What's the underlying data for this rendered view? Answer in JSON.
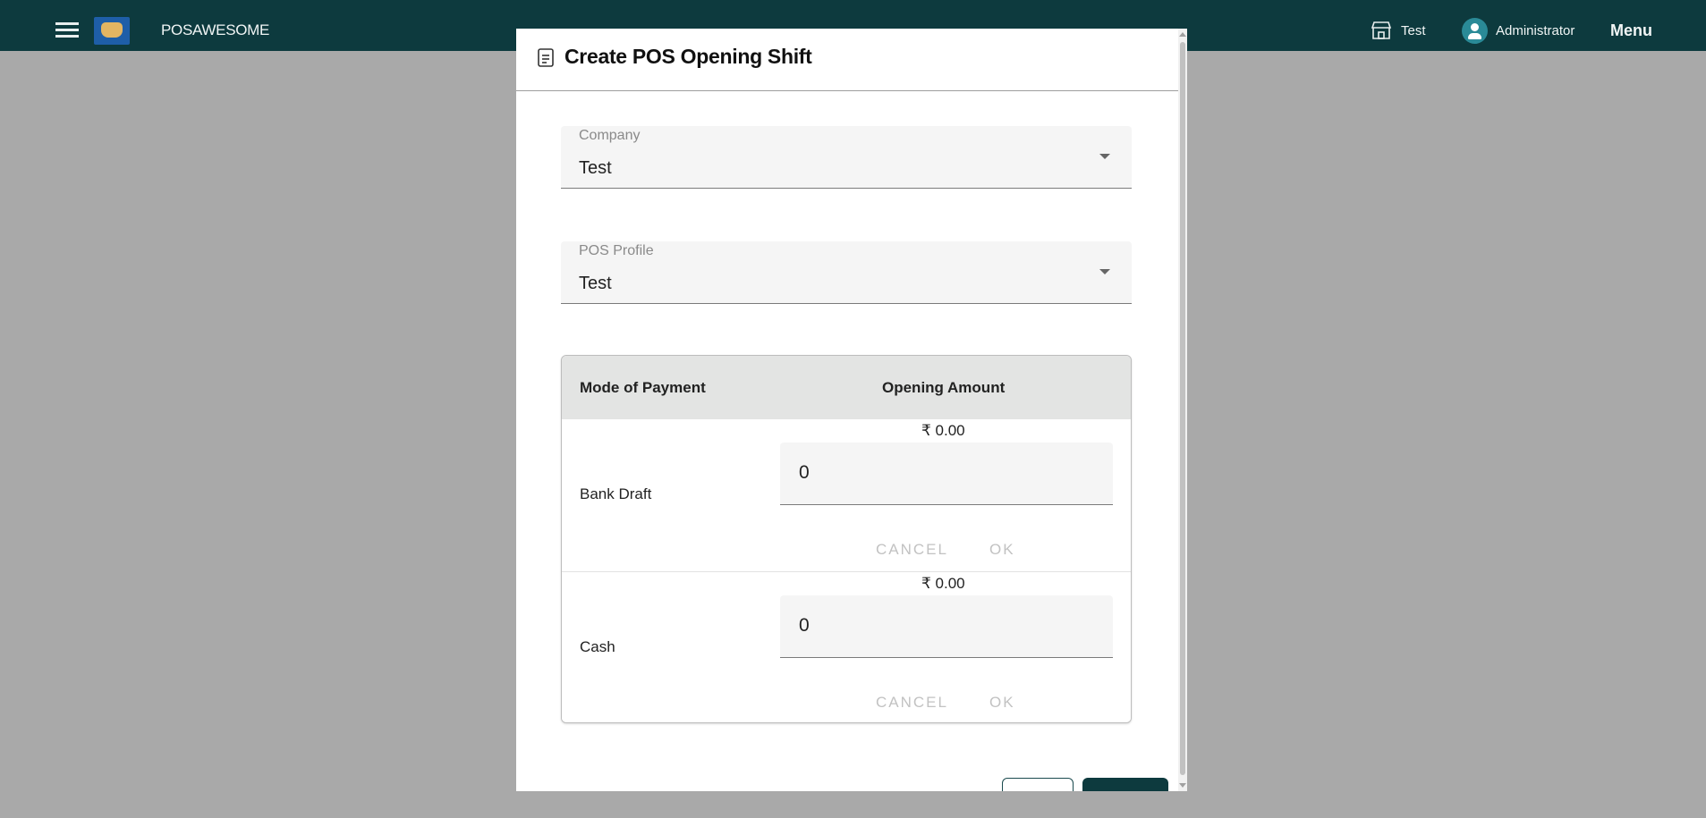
{
  "app": {
    "brand": "POSAWESOME",
    "store_label": "Test",
    "user_label": "Administrator",
    "menu_label": "Menu",
    "icons": {
      "hamburger": "hamburger-menu-icon",
      "logo": "pos-logo",
      "store": "store-icon",
      "user": "account-circle-icon"
    },
    "colors": {
      "topbar": "#0d3a3e",
      "overlay": "#a9a9a9",
      "accent": "#2a8a97"
    }
  },
  "dialog": {
    "title": "Create POS Opening Shift",
    "company": {
      "label": "Company",
      "value": "Test"
    },
    "pos_profile": {
      "label": "POS Profile",
      "value": "Test"
    },
    "table": {
      "headers": {
        "mode": "Mode of Payment",
        "amount": "Opening Amount"
      },
      "rows": [
        {
          "mode": "Bank Draft",
          "display": "₹ 0.00",
          "input": "0",
          "cancel": "CANCEL",
          "ok": "OK"
        },
        {
          "mode": "Cash",
          "display": "₹ 0.00",
          "input": "0",
          "cancel": "CANCEL",
          "ok": "OK"
        }
      ]
    }
  }
}
